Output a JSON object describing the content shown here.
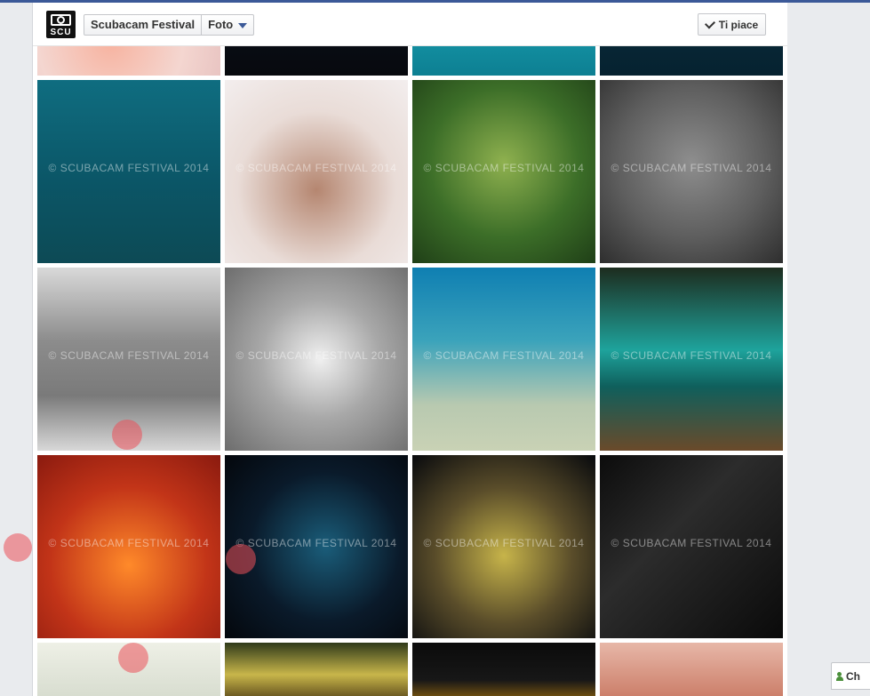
{
  "page": {
    "brand_logo_text": "SCU",
    "breadcrumb": {
      "page_name": "Scubacam Festival",
      "section": "Foto"
    },
    "like_button_label": "Ti piace",
    "watermark": "© SCUBACAM FESTIVAL 2014",
    "chat_label": "Ch"
  },
  "photos": [
    {
      "id": "r0c0",
      "bg": "radial-gradient(circle at 40% 60%, #f7b3a0, #f4d6d0 60%, #e7c2c0)"
    },
    {
      "id": "r0c1",
      "bg": "linear-gradient(#0c121c,#07090e)"
    },
    {
      "id": "r0c2",
      "bg": "linear-gradient(#1ba6b6,#0d7f92)"
    },
    {
      "id": "r0c3",
      "bg": "linear-gradient(#0a2c3c,#062230)"
    },
    {
      "id": "r1c0",
      "bg": "linear-gradient(#0f6d80,#0b5667 55%,#0d4a55)"
    },
    {
      "id": "r1c1",
      "bg": "radial-gradient(circle at 50% 60%, #b58670, #e9dcd7 55%, #f3eeee)"
    },
    {
      "id": "r1c2",
      "bg": "radial-gradient(circle at 50% 45%, #8fb14f, #3c6e28 55%, #1f3f17)"
    },
    {
      "id": "r1c3",
      "bg": "radial-gradient(circle at 50% 45%, #8e8e8e, #5e5e5e 55%, #2e2e2e)"
    },
    {
      "id": "r2c0",
      "bg": "linear-gradient(#d9d9d9,#8c8c8c 40%,#7a7a7a 70%,#d8d8d8)"
    },
    {
      "id": "r2c1",
      "bg": "radial-gradient(circle at 52% 50%, #f0f0f0, #a8a8a8 45%, #6d6d6d)"
    },
    {
      "id": "r2c2",
      "bg": "linear-gradient(#0f7fb2,#3ba3bb 40%,#b8c9b0 75%,#c9d2b5)"
    },
    {
      "id": "r2c3",
      "bg": "linear-gradient(#1d2c1e,#1ea39c 45%,#0f5f5c 65%,#6a4a2a)"
    },
    {
      "id": "r3c0",
      "bg": "radial-gradient(circle at 50% 60%, #ff8a2a, #c23418 55%, #8a1a0f)"
    },
    {
      "id": "r3c1",
      "bg": "radial-gradient(circle at 55% 50%, #1a5d7a, #0a1a2a 55%, #04070c)"
    },
    {
      "id": "r3c2",
      "bg": "radial-gradient(circle at 50% 55%, #c7b44a, #5a4d2a 50%, #07090d)"
    },
    {
      "id": "r3c3",
      "bg": "linear-gradient(135deg,#0c0c0c,#2c2c2c 40%,#0a0a0a)"
    },
    {
      "id": "r4c0",
      "bg": "linear-gradient(#eef0e6,#d8ddd0)"
    },
    {
      "id": "r4c1",
      "bg": "linear-gradient(#2f3a1a,#c8b64a 60%,#6c5a22)"
    },
    {
      "id": "r4c2",
      "bg": "linear-gradient(#0b0b0b,#171717 70%,#6b4d10)"
    },
    {
      "id": "r4c3",
      "bg": "linear-gradient(#e7b7a8,#cc7f6a)"
    }
  ]
}
